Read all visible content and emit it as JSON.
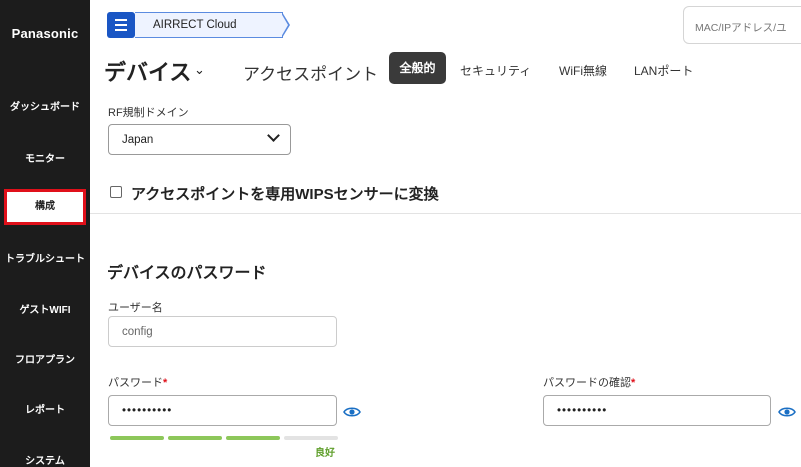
{
  "sidebar": {
    "brand": "Panasonic",
    "items": [
      {
        "label": "ダッシュボード"
      },
      {
        "label": "モニター"
      },
      {
        "label": "構成"
      },
      {
        "label": "トラブルシュート"
      },
      {
        "label": "ゲストWIFI"
      },
      {
        "label": "フロアプラン"
      },
      {
        "label": "レポート"
      },
      {
        "label": "システム"
      }
    ],
    "active_index": 2
  },
  "header": {
    "breadcrumb": "AIRRECT Cloud",
    "search_placeholder": "MAC/IPアドレス/ユ"
  },
  "page": {
    "title": "デバイス",
    "subtitle": "アクセスポイント",
    "tabs": [
      {
        "label": "全般的",
        "active": true
      },
      {
        "label": "セキュリティ",
        "active": false
      },
      {
        "label": "WiFi無線",
        "active": false
      },
      {
        "label": "LANポート",
        "active": false
      }
    ]
  },
  "form": {
    "rf_domain_label": "RF規制ドメイン",
    "rf_domain_value": "Japan",
    "wips_checkbox_label": "アクセスポイントを専用WIPSセンサーに変換",
    "wips_checked": false,
    "password_section_title": "デバイスのパスワード",
    "username_label": "ユーザー名",
    "username_value": "config",
    "password_label": "パスワード",
    "password_value": "••••••••••",
    "password_confirm_label": "パスワードの確認",
    "password_confirm_value": "••••••••••",
    "required_mark": "*",
    "strength_text": "良好",
    "strength_segments_filled": 3,
    "strength_segments_total": 4
  },
  "colors": {
    "sidebar_bg": "#1c1c1c",
    "accent_blue": "#1a56c4",
    "active_highlight": "#e0101a",
    "strength_good": "#8dc75a",
    "strength_empty": "#e3e3e3",
    "eye_icon": "#1a6fc4"
  }
}
